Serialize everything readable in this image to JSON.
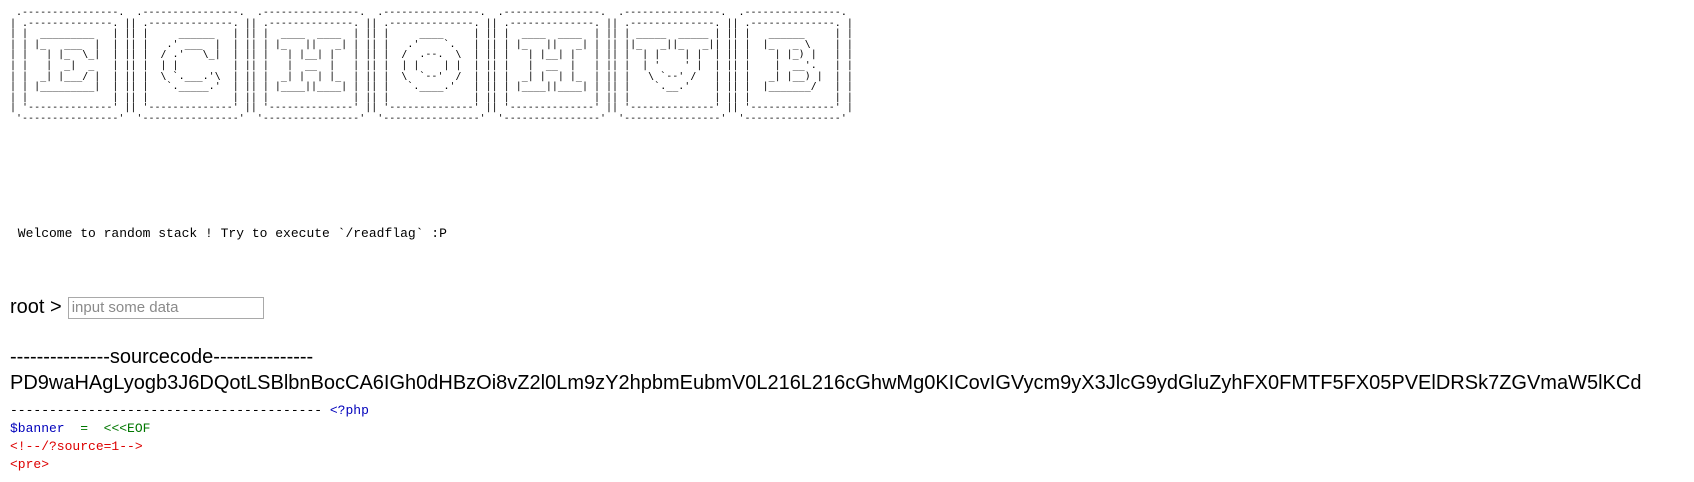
{
  "banner": {
    "ascii_art": " .----------------.  .----------------.  .----------------.  .----------------.  .----------------.  .----------------.  .----------------. \n| .--------------. || .--------------. || .--------------. || .--------------. || .--------------. || .--------------. || .--------------. |\n| |  _________   | || |     ______   | || |  ____  ____  | || |     ____     | || |  ____  ____  | || | _____  _____ | || |   ______     | |\n| | |_   ___  |  | || |   .' ___  |  | || | |_   ||   _| | || |   .'    `.   | || | |_   ||   _| | || ||_   _||_   _|| || |  |_   _ \\    | |\n| |   | |_  \\_|  | || |  / .'   \\_|  | || |   | |__| |   | || |  /  .--.  \\  | || |   | |__| |   | || |  | |    | |  | || |    | |_) |   | |\n| |   |  _|  _   | || |  | |         | || |   |  __  |   | || |  | |    | |  | || |   |  __  |   | || |  | '    ' |  | || |    |  __'.   | |\n| |  _| |___/ |  | || |  \\ `.___.'\\  | || |  _| |  | |_  | || |  \\  `--'  /  | || |  _| |  | |_  | || |   \\ `--' /   | || |   _| |__) |  | |\n| | |_________|  | || |   `._____.'  | || | |____||____| | || |   `.____.'   | || | |____||____| | || |    `.__.'    | || |  |_______/   | |\n| |              | || |              | || |              | || |              | || |              | || |              | || |              | |\n| '--------------' || '--------------' || '--------------' || '--------------' || '--------------' || '--------------' || '--------------' |\n '----------------'  '----------------'  '----------------'  '----------------'  '----------------'  '----------------'  '----------------' "
  },
  "welcome_text": " Welcome to random stack ! Try to execute `/readflag` :P",
  "prompt": {
    "label": "root >",
    "input_value": "",
    "input_placeholder": "input some data"
  },
  "source": {
    "header": "---------------sourcecode---------------",
    "base64": "PD9waHAgLyogb3J6DQotLSBlbnBocCA6IGh0dHBzOi8vZ2l0Lm9zY2hpbmEubmV0L216L216cGhwMg0KICovIGVycm9yX3JlcG9ydGluZyhFX0FMTF5FX05PVElDRSk7ZGVmaW5lKCd"
  },
  "code": {
    "dashes": "----------------------------------------",
    "php_open": "<?php",
    "line1_var": "$banner",
    "line1_op": "=",
    "line1_heredoc": "<<<EOF",
    "line2": "<!--/?source=1-->",
    "line3": "<pre>"
  },
  "colors": {
    "php_keyword": "#0000bb",
    "php_operator": "#007700",
    "php_string": "#dd0000"
  }
}
